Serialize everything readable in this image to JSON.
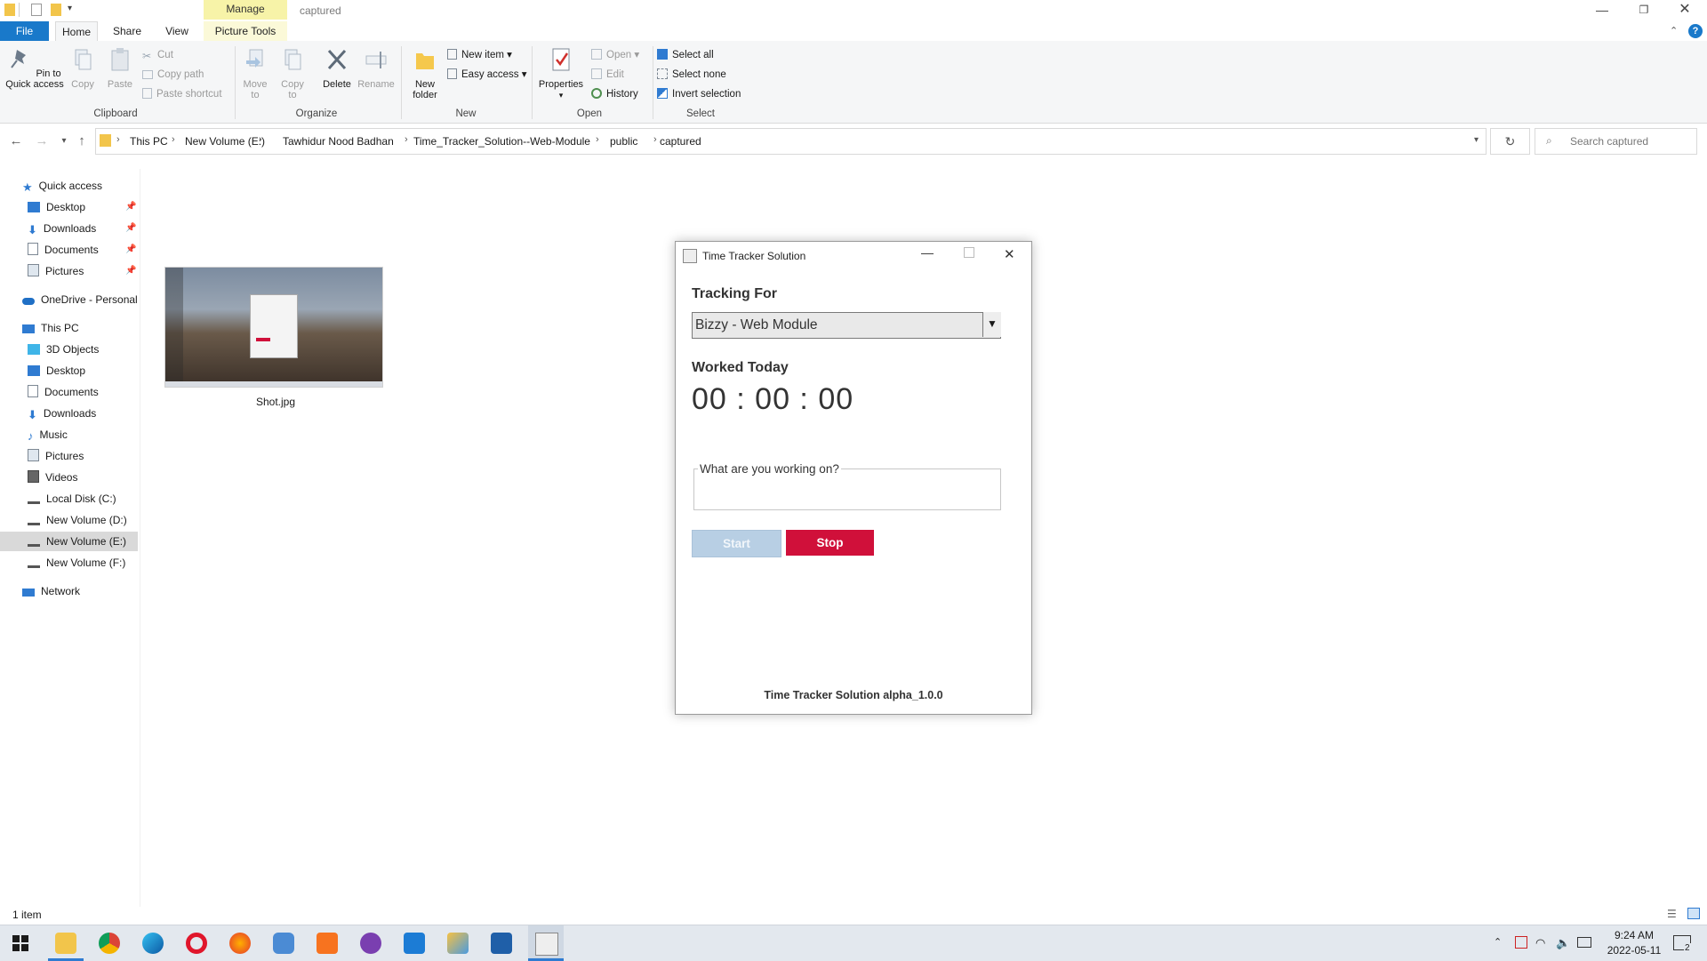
{
  "window": {
    "title": "captured",
    "context_tab_group": "Manage"
  },
  "ribbon_tabs": [
    {
      "label": "File"
    },
    {
      "label": "Home"
    },
    {
      "label": "Share"
    },
    {
      "label": "View"
    },
    {
      "label": "Picture Tools"
    }
  ],
  "ribbon": {
    "clipboard": {
      "pin_label": "Pin to Quick access",
      "copy": "Copy",
      "paste": "Paste",
      "cut": "Cut",
      "copy_path": "Copy path",
      "paste_shortcut": "Paste shortcut",
      "group": "Clipboard"
    },
    "organize": {
      "move_to": "Move to",
      "copy_to": "Copy to",
      "delete": "Delete",
      "rename": "Rename",
      "group": "Organize"
    },
    "new": {
      "new_folder": "New folder",
      "new_item": "New item",
      "easy_access": "Easy access",
      "group": "New"
    },
    "open": {
      "properties": "Properties",
      "open": "Open",
      "edit": "Edit",
      "history": "History",
      "group": "Open"
    },
    "select": {
      "select_all": "Select all",
      "select_none": "Select none",
      "invert_selection": "Invert selection",
      "group": "Select"
    }
  },
  "address": {
    "crumbs": [
      "This PC",
      "New Volume (E:)",
      "Tawhidur Nood Badhan",
      "Time_Tracker_Solution--Web-Module",
      "public",
      "captured"
    ],
    "search_placeholder": "Search captured"
  },
  "nav": {
    "quick_access": "Quick access",
    "quick_items": [
      "Desktop",
      "Downloads",
      "Documents",
      "Pictures"
    ],
    "onedrive": "OneDrive - Personal",
    "this_pc": "This PC",
    "pc_items": [
      "3D Objects",
      "Desktop",
      "Documents",
      "Downloads",
      "Music",
      "Pictures",
      "Videos",
      "Local Disk (C:)",
      "New Volume (D:)",
      "New Volume (E:)",
      "New Volume (F:)"
    ],
    "network": "Network"
  },
  "files": [
    {
      "name": "Shot.jpg"
    }
  ],
  "status": {
    "count": "1 item"
  },
  "app": {
    "title": "Time Tracker Solution",
    "tracking_for_label": "Tracking For",
    "project_selected": "Bizzy - Web Module",
    "worked_today_label": "Worked Today",
    "timer": "00 : 00 : 00",
    "task_legend": "What are you working on?",
    "task_value": "",
    "start_label": "Start",
    "stop_label": "Stop",
    "footer": "Time Tracker Solution alpha_1.0.0",
    "colors": {
      "stop": "#d0103a",
      "start_disabled": "#b8cfe4"
    }
  },
  "taskbar": {
    "apps": [
      "file-explorer",
      "chrome",
      "edge",
      "opera",
      "firefox",
      "app-hex",
      "xampp",
      "github-desktop",
      "vscode",
      "pinned-app",
      "photos",
      "java"
    ],
    "time": "9:24 AM",
    "date": "2022-05-11",
    "notification_count": "2"
  }
}
